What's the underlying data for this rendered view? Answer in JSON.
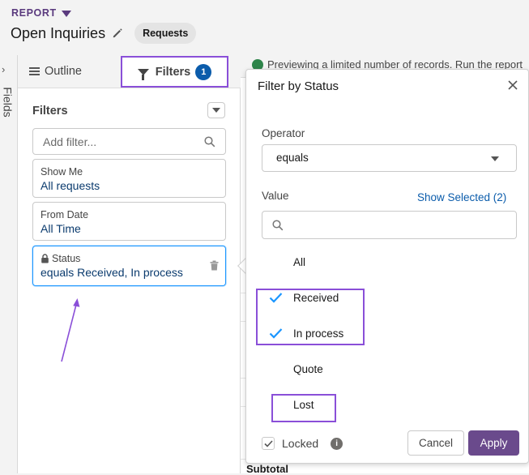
{
  "header": {
    "report_label": "REPORT",
    "title": "Open Inquiries",
    "report_type": "Requests"
  },
  "rail": {
    "label": "Fields"
  },
  "panel": {
    "tabs": {
      "outline": "Outline",
      "filters": "Filters",
      "filters_count": "1"
    },
    "filters_heading": "Filters",
    "add_filter_placeholder": "Add filter...",
    "filters": [
      {
        "label": "Show Me",
        "value": "All requests"
      },
      {
        "label": "From Date",
        "value": "All Time"
      },
      {
        "label": "Status",
        "value": "equals Received, In process",
        "locked": true
      }
    ]
  },
  "preview": {
    "text": "Previewing a limited number of records. Run the report"
  },
  "table": {
    "subtotal": "Subtotal"
  },
  "popover": {
    "title": "Filter by Status",
    "operator_label": "Operator",
    "operator_value": "equals",
    "value_label": "Value",
    "show_selected": "Show Selected (2)",
    "options": [
      {
        "label": "All",
        "checked": false
      },
      {
        "label": "Received",
        "checked": true
      },
      {
        "label": "In process",
        "checked": true
      },
      {
        "label": "Quote",
        "checked": false
      },
      {
        "label": "Lost",
        "checked": false
      }
    ],
    "locked_label": "Locked",
    "locked_checked": true,
    "cancel_label": "Cancel",
    "apply_label": "Apply"
  },
  "colors": {
    "accent_purple": "#8a4fd8",
    "brand_purple": "#6a4a8c",
    "link_blue": "#0b5cab",
    "check_blue": "#1b96ff"
  },
  "icons": [
    "caret-down-icon",
    "pencil-icon",
    "chevron-right-icon",
    "list-icon",
    "funnel-icon",
    "search-icon",
    "lock-icon",
    "trash-icon",
    "close-icon",
    "checkmark-icon",
    "info-icon",
    "success-icon"
  ]
}
